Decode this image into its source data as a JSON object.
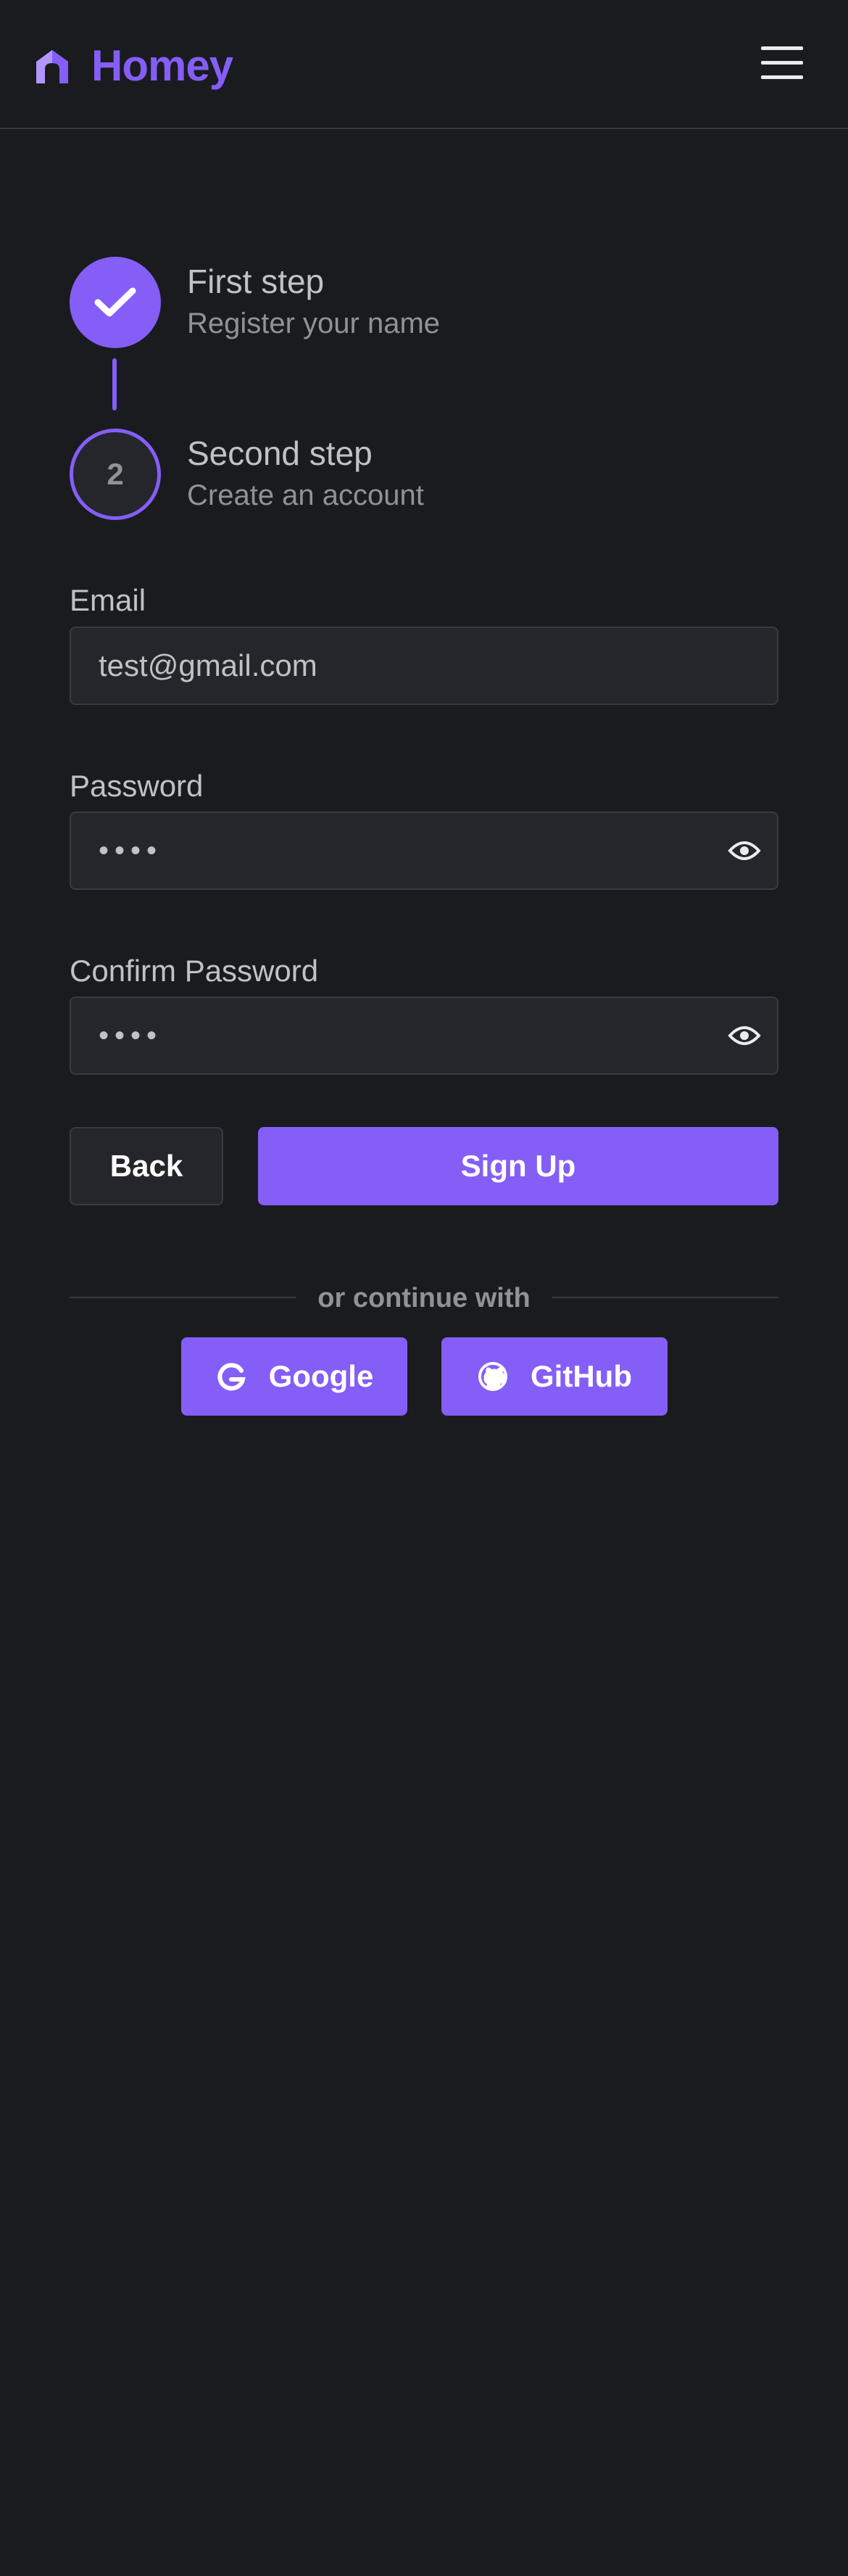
{
  "header": {
    "logo_text": "Homey"
  },
  "stepper": {
    "steps": [
      {
        "title": "First step",
        "description": "Register your name",
        "state": "completed"
      },
      {
        "title": "Second step",
        "description": "Create an account",
        "state": "active",
        "number": "2"
      }
    ]
  },
  "form": {
    "email": {
      "label": "Email",
      "value": "test@gmail.com"
    },
    "password": {
      "label": "Password",
      "value": "••••"
    },
    "confirm_password": {
      "label": "Confirm Password",
      "value": "••••"
    }
  },
  "actions": {
    "back_label": "Back",
    "signup_label": "Sign Up"
  },
  "social": {
    "divider_text": "or continue with",
    "google_label": "Google",
    "github_label": "GitHub"
  },
  "colors": {
    "accent": "#845ef7",
    "background": "#1a1b1e",
    "input_bg": "#25262b",
    "border": "#373a40"
  }
}
